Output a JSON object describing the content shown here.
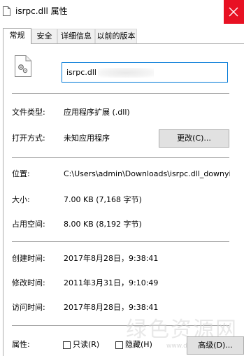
{
  "window": {
    "title": "isrpc.dll 属性",
    "close_icon": "close-icon"
  },
  "tabs": [
    {
      "label": "常规",
      "active": true
    },
    {
      "label": "安全",
      "active": false
    },
    {
      "label": "详细信息",
      "active": false
    },
    {
      "label": "以前的版本",
      "active": false
    }
  ],
  "general": {
    "file_name": "isrpc.dll",
    "file_type_label": "文件类型:",
    "file_type_value": "应用程序扩展 (.dll)",
    "open_with_label": "打开方式:",
    "open_with_value": "未知应用程序",
    "change_button": "更改(C)...",
    "location_label": "位置:",
    "location_value": "C:\\Users\\admin\\Downloads\\isrpc.dll_downyi.com",
    "size_label": "大小:",
    "size_value": "7.00 KB (7,168 字节)",
    "size_on_disk_label": "占用空间:",
    "size_on_disk_value": "8.00 KB (8,192 字节)",
    "created_label": "创建时间:",
    "created_value": "2017年8月28日，9:38:41",
    "modified_label": "修改时间:",
    "modified_value": "2011年3月31日，9:10:49",
    "accessed_label": "访问时间:",
    "accessed_value": "2017年8月28日，9:38:41",
    "attributes_label": "属性:",
    "readonly_label": "只读(R)",
    "hidden_label": "隐藏(H)",
    "advanced_button": "高级(D)..."
  },
  "watermark": {
    "text": "绿色资源网",
    "url": "www.downcc.com"
  }
}
